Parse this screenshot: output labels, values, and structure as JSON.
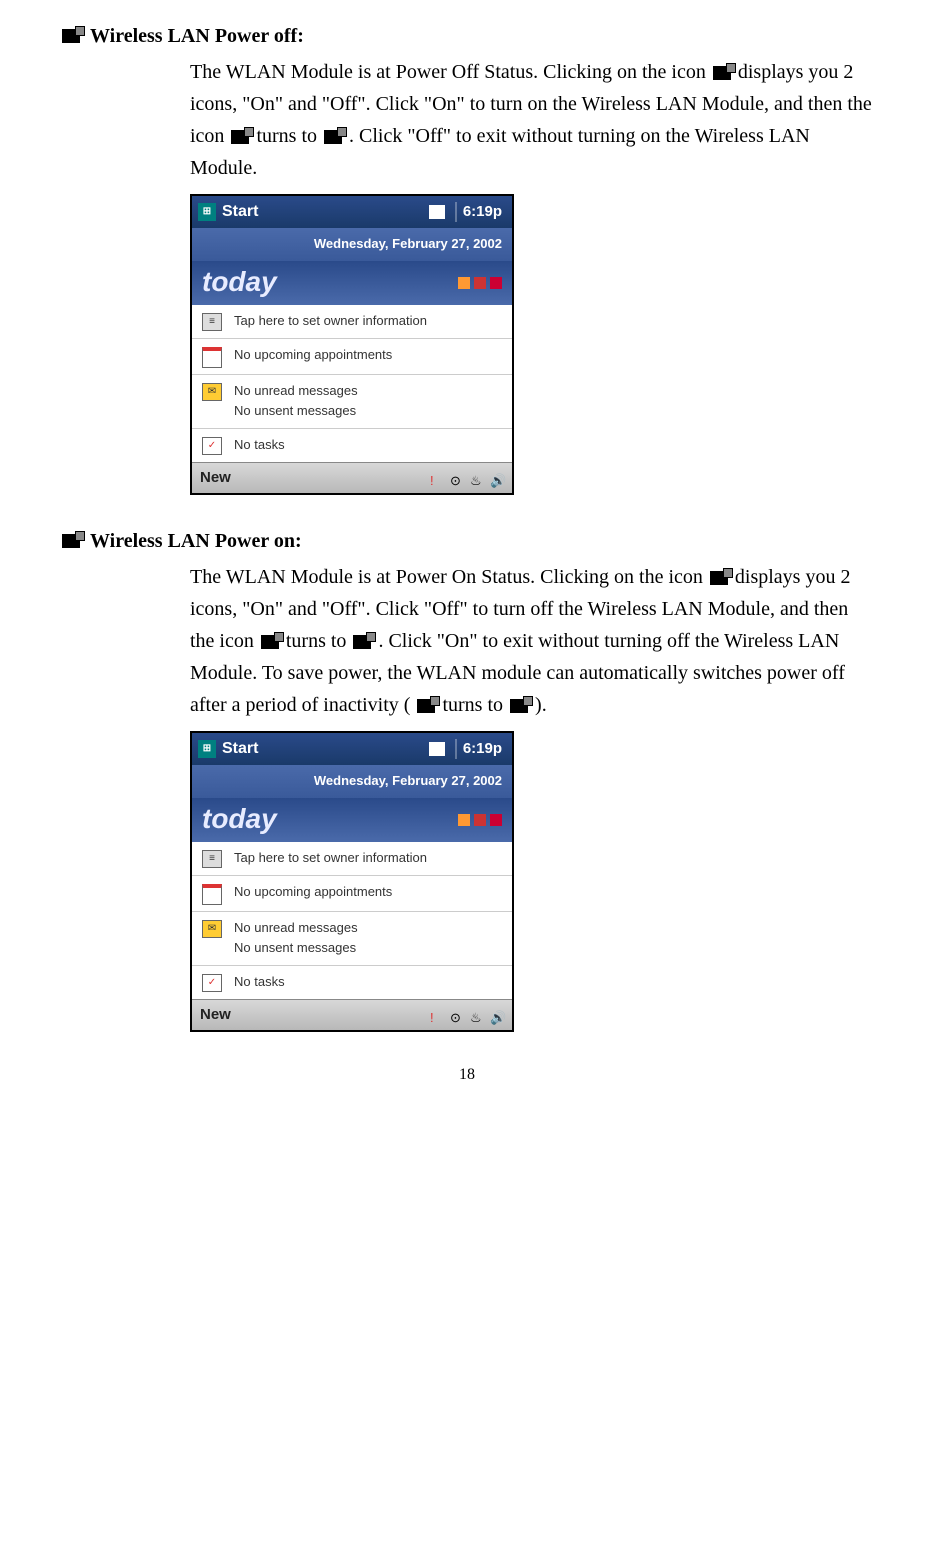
{
  "section1": {
    "title": "Wireless LAN Power off:",
    "description_parts": {
      "p1": "The WLAN Module is at Power Off Status.    Clicking on the icon ",
      "p2": " displays you 2 icons, \"On\" and \"Off\".    Click \"On\" to turn on the Wireless LAN Module, and then the icon ",
      "p3": " turns to ",
      "p4": ".    Click \"Off\" to exit without turning on the Wireless LAN Module."
    }
  },
  "section2": {
    "title": "Wireless LAN Power on:",
    "description_parts": {
      "p1": "The WLAN Module is at Power On Status.     Clicking on the icon ",
      "p2": " displays you 2 icons, \"On\" and \"Off\".    Click \"Off\" to turn off the Wireless LAN Module, and then the icon ",
      "p3": " turns to ",
      "p4": ".    Click \"On\" to exit without turning off the Wireless LAN Module.    To save power, the WLAN module can automatically switches power off after a period of inactivity (",
      "p5": " turns to ",
      "p6": ")."
    }
  },
  "screenshot": {
    "start": "Start",
    "time": "6:19p",
    "date": "Wednesday, February 27, 2002",
    "today": "today",
    "items": {
      "owner": "Tap here to set owner information",
      "appointments": "No upcoming appointments",
      "msg1": "No unread messages",
      "msg2": "No unsent messages",
      "tasks": "No tasks"
    },
    "new_btn": "New"
  },
  "page_number": "18"
}
